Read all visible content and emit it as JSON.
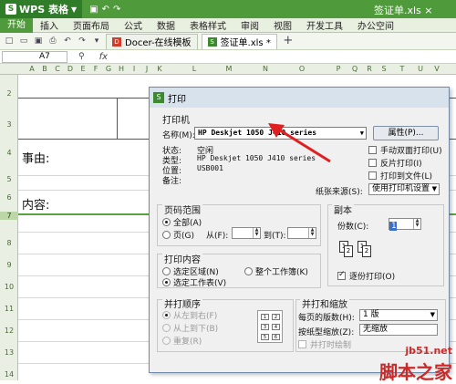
{
  "app": {
    "name": "WPS 表格",
    "logo_letter": "S",
    "window_title": "签证单.xls ×"
  },
  "menubar": {
    "items": [
      "开始",
      "插入",
      "页面布局",
      "公式",
      "数据",
      "表格样式",
      "审阅",
      "视图",
      "开发工具",
      "办公空间"
    ]
  },
  "tabs": [
    {
      "label": "Docer-在线模板",
      "active": false
    },
    {
      "label": "签证单.xls *",
      "active": true
    }
  ],
  "formula_bar": {
    "name_box": "A7",
    "fx": "fx"
  },
  "columns": [
    "A",
    "B",
    "C",
    "D",
    "E",
    "F",
    "G",
    "H",
    "I",
    "J",
    "K",
    "L",
    "M",
    "N",
    "O",
    "P",
    "Q",
    "R",
    "S",
    "T",
    "U",
    "V"
  ],
  "rows": [
    "1",
    "2",
    "3",
    "4",
    "5",
    "6",
    "7",
    "8",
    "9",
    "10",
    "11",
    "12",
    "13",
    "14"
  ],
  "selected_row": "7",
  "sheet": {
    "cell_shiyou": "事由:",
    "cell_neirong": "内容:"
  },
  "dialog": {
    "title": "打印",
    "printer_section": "打印机",
    "name_label": "名称(M):",
    "printer_name": "HP Deskjet 1050 J410 series",
    "properties_button": "属性(P)...",
    "status_label": "状态:",
    "status_value": "空闲",
    "type_label": "类型:",
    "type_value": "HP Deskjet 1050 J410 series",
    "location_label": "位置:",
    "location_value": "USB001",
    "comment_label": "备注:",
    "duplex_label": "手动双面打印(U)",
    "duplex_checked": false,
    "reverse_label": "反片打印(I)",
    "reverse_checked": false,
    "to_file_label": "打印到文件(L)",
    "to_file_checked": false,
    "paper_source_label": "纸张来源(S):",
    "paper_source_value": "使用打印机设置",
    "page_range_section": "页码范围",
    "range_all": "全部(A)",
    "range_pages": "页(G)",
    "range_from": "从(F):",
    "range_to": "到(T):",
    "copies_section": "副本",
    "copies_label": "份数(C):",
    "copies_value": "1",
    "collate_label": "逐份打印(O)",
    "collate_checked": true,
    "print_content_section": "打印内容",
    "content_selection": "选定区域(N)",
    "content_workbook": "整个工作簿(K)",
    "content_sheet": "选定工作表(V)",
    "order_section": "并打顺序",
    "order_lr": "从左到右(F)",
    "order_tb": "从上到下(B)",
    "order_repeat": "重复(R)",
    "zoom_section": "并打和缩放",
    "pages_per_sheet_label": "每页的版数(H):",
    "pages_per_sheet_value": "1 版",
    "scale_label": "按纸型缩放(Z):",
    "scale_value": "无缩放",
    "cut_line_label": "并打时绘制"
  },
  "watermark": {
    "url": "jb51.net",
    "name": "脚本之家"
  },
  "colors": {
    "accent": "#4f9a3a",
    "arrow": "#e02020",
    "watermark": "#c92b2b"
  }
}
